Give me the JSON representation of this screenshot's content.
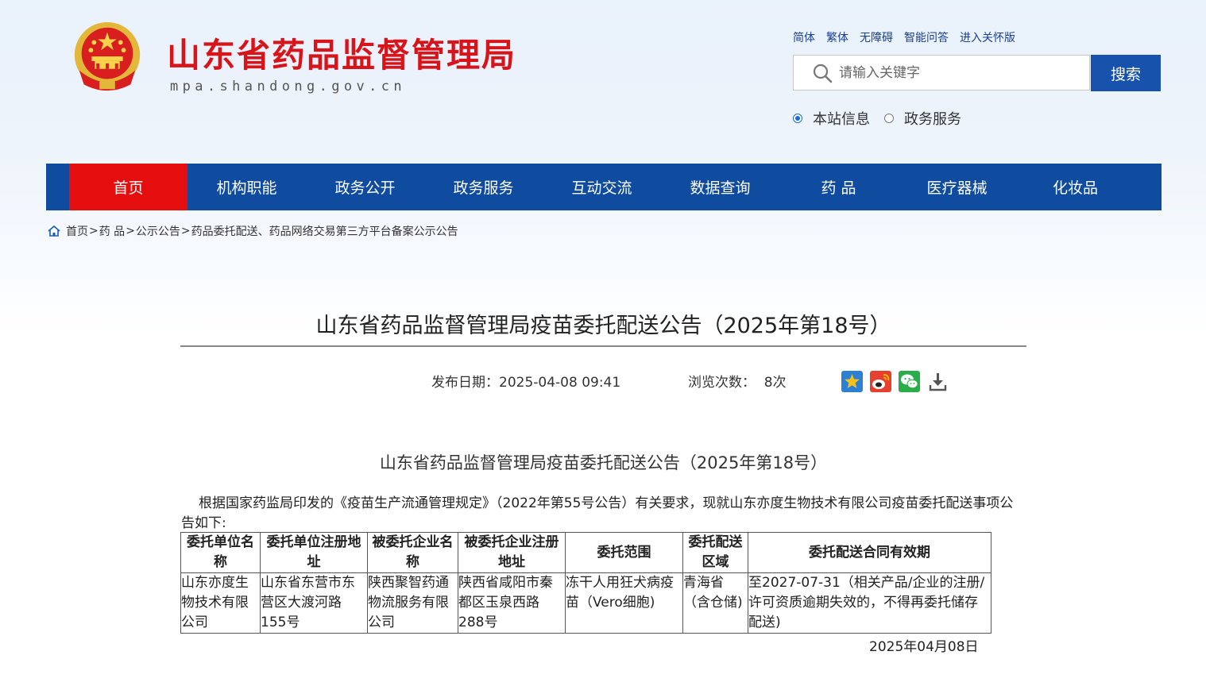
{
  "header": {
    "site_title": "山东省药品监督管理局",
    "site_url": "mpa.shandong.gov.cn",
    "top_links": [
      "简体",
      "繁体",
      "无障碍",
      "智能问答",
      "进入关怀版"
    ],
    "search": {
      "placeholder": "请输入关键字",
      "button": "搜索"
    },
    "scope_options": [
      {
        "label": "本站信息",
        "selected": true
      },
      {
        "label": "政务服务",
        "selected": false
      }
    ]
  },
  "nav": {
    "items": [
      "首页",
      "机构职能",
      "政务公开",
      "政务服务",
      "互动交流",
      "数据查询",
      "药 品",
      "医疗器械",
      "化妆品"
    ],
    "active_index": 0
  },
  "breadcrumb": [
    "首页",
    "药 品",
    "公示公告",
    "药品委托配送、药品网络交易第三方平台备案公示公告"
  ],
  "article": {
    "title": "山东省药品监督管理局疫苗委托配送公告（2025年第18号）",
    "publish_date": "发布日期：2025-04-08 09:41",
    "views": "浏览次数：  8次",
    "share_icons": [
      "favorite-icon",
      "weibo-icon",
      "wechat-icon",
      "download-icon"
    ],
    "subtitle": "山东省药品监督管理局疫苗委托配送公告（2025年第18号）",
    "intro": "根据国家药监局印发的《疫苗生产流通管理规定》（2022年第55号公告）有关要求，现就山东亦度生物技术有限公司疫苗委托配送事项公告如下:",
    "table": {
      "headers": [
        "委托单位名称",
        "委托单位注册地址",
        "被委托企业名称",
        "被委托企业注册地址",
        "委托范围",
        "委托配送区域",
        "委托配送合同有效期"
      ],
      "rows": [
        [
          "山东亦度生物技术有限公司",
          "山东省东营市东营区大渡河路155号",
          "陕西聚智药通物流服务有限公司",
          "陕西省咸阳市秦都区玉泉西路288号",
          "冻干人用狂犬病疫苗（Vero细胞)",
          "青海省（含仓储)",
          "至2027-07-31（相关产品/企业的注册/许可资质逾期失效的，不得再委托储存配送)"
        ]
      ]
    },
    "sign_date": "2025年04月08日"
  },
  "colors": {
    "brand_red": "#d8141b",
    "nav_blue": "#0f4b9f",
    "nav_active": "#e50e0e",
    "search_blue": "#1752ad"
  }
}
